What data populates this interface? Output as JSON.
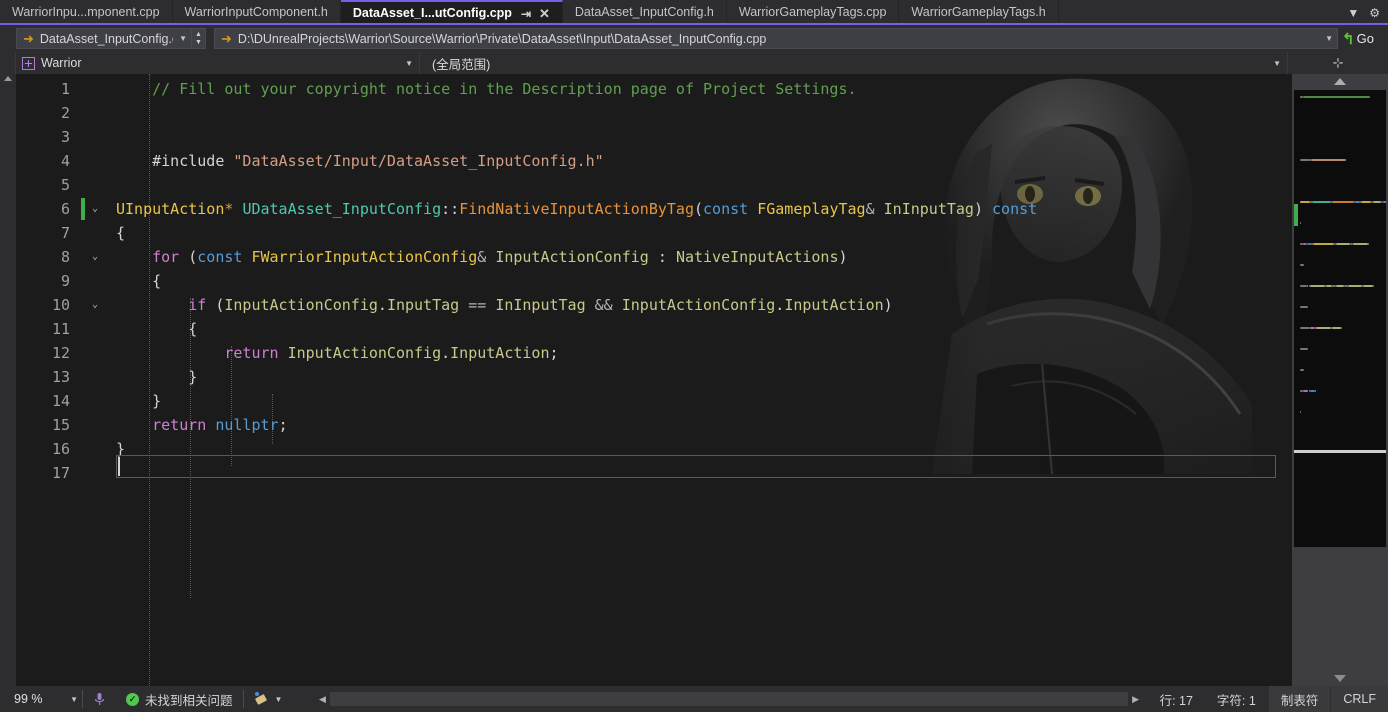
{
  "tabs": [
    {
      "label": "WarriorInpu...mponent.cpp",
      "active": false
    },
    {
      "label": "WarriorInputComponent.h",
      "active": false
    },
    {
      "label": "DataAsset_I...utConfig.cpp",
      "active": true,
      "pin": "⇥",
      "close": "✕"
    },
    {
      "label": "DataAsset_InputConfig.h",
      "active": false
    },
    {
      "label": "WarriorGameplayTags.cpp",
      "active": false
    },
    {
      "label": "WarriorGameplayTags.h",
      "active": false
    }
  ],
  "tabstrip_right": {
    "overflow_icon": "▼",
    "settings_icon": "⚙"
  },
  "navbar": {
    "back_arrow": "➜",
    "file_name": "DataAsset_InputConfig.c",
    "caret": "▼",
    "spin_up": "▲",
    "spin_down": "▼",
    "path_arrow": "➜",
    "path": "D:\\DUnrealProjects\\Warrior\\Source\\Warrior\\Private\\DataAsset\\Input\\DataAsset_InputConfig.cpp",
    "path_caret": "▼",
    "go_label": "Go",
    "go_arrow": "↰"
  },
  "scopebar": {
    "project": "Warrior",
    "project_caret": "▼",
    "scope": "(全局范围)",
    "scope_caret": "▼",
    "split_icon": "⊹"
  },
  "editor": {
    "colors": {
      "background": "#1b1b1b",
      "comment": "#5fa04e",
      "string": "#d69d85",
      "type": "#e8c547",
      "class": "#4ec9b0",
      "function": "#e8923c",
      "keyword": "#569cd6",
      "control": "#d17fd1",
      "variable": "#c8c88a",
      "accent": "#7160e8",
      "change_bar": "#3fae4a"
    },
    "lines": [
      {
        "n": "1",
        "fold": "",
        "change": false,
        "tokens": [
          {
            "t": "    ",
            "c": "c-punct"
          },
          {
            "t": "// Fill out your copyright notice in the Description page of Project Settings.",
            "c": "c-comment"
          }
        ]
      },
      {
        "n": "2",
        "fold": "",
        "change": false,
        "tokens": []
      },
      {
        "n": "3",
        "fold": "",
        "change": false,
        "tokens": []
      },
      {
        "n": "4",
        "fold": "",
        "change": false,
        "tokens": [
          {
            "t": "    #include ",
            "c": "c-pre"
          },
          {
            "t": "\"DataAsset/Input/DataAsset_InputConfig.h\"",
            "c": "c-str"
          }
        ]
      },
      {
        "n": "5",
        "fold": "",
        "change": false,
        "tokens": []
      },
      {
        "n": "6",
        "fold": "⌄",
        "change": true,
        "tokens": [
          {
            "t": "UInputAction",
            "c": "c-type"
          },
          {
            "t": "* ",
            "c": "c-func"
          },
          {
            "t": "UDataAsset_InputConfig",
            "c": "c-class"
          },
          {
            "t": "::",
            "c": "c-punct"
          },
          {
            "t": "FindNativeInputActionByTag",
            "c": "c-func"
          },
          {
            "t": "(",
            "c": "c-punct"
          },
          {
            "t": "const",
            "c": "c-kw"
          },
          {
            "t": " ",
            "c": "c-punct"
          },
          {
            "t": "FGameplayTag",
            "c": "c-type"
          },
          {
            "t": "& ",
            "c": "c-op"
          },
          {
            "t": "InInputTag",
            "c": "c-var"
          },
          {
            "t": ") ",
            "c": "c-punct"
          },
          {
            "t": "const",
            "c": "c-kw"
          }
        ]
      },
      {
        "n": "7",
        "fold": "",
        "change": false,
        "tokens": [
          {
            "t": "{",
            "c": "c-punct"
          }
        ]
      },
      {
        "n": "8",
        "fold": "⌄",
        "change": false,
        "tokens": [
          {
            "t": "    ",
            "c": "c-punct"
          },
          {
            "t": "for",
            "c": "c-ctrl"
          },
          {
            "t": " (",
            "c": "c-punct"
          },
          {
            "t": "const",
            "c": "c-kw"
          },
          {
            "t": " ",
            "c": "c-punct"
          },
          {
            "t": "FWarriorInputActionConfig",
            "c": "c-type"
          },
          {
            "t": "& ",
            "c": "c-op"
          },
          {
            "t": "InputActionConfig",
            "c": "c-var"
          },
          {
            "t": " : ",
            "c": "c-punct"
          },
          {
            "t": "NativeInputActions",
            "c": "c-var"
          },
          {
            "t": ")",
            "c": "c-punct"
          }
        ]
      },
      {
        "n": "9",
        "fold": "",
        "change": false,
        "tokens": [
          {
            "t": "    {",
            "c": "c-punct"
          }
        ]
      },
      {
        "n": "10",
        "fold": "⌄",
        "change": false,
        "tokens": [
          {
            "t": "        ",
            "c": "c-punct"
          },
          {
            "t": "if",
            "c": "c-ctrl"
          },
          {
            "t": " (",
            "c": "c-punct"
          },
          {
            "t": "InputActionConfig",
            "c": "c-var"
          },
          {
            "t": ".",
            "c": "c-punct"
          },
          {
            "t": "InputTag",
            "c": "c-var"
          },
          {
            "t": " == ",
            "c": "c-op"
          },
          {
            "t": "InInputTag",
            "c": "c-var"
          },
          {
            "t": " && ",
            "c": "c-op"
          },
          {
            "t": "InputActionConfig",
            "c": "c-var"
          },
          {
            "t": ".",
            "c": "c-punct"
          },
          {
            "t": "InputAction",
            "c": "c-var"
          },
          {
            "t": ")",
            "c": "c-punct"
          }
        ]
      },
      {
        "n": "11",
        "fold": "",
        "change": false,
        "tokens": [
          {
            "t": "        {",
            "c": "c-punct"
          }
        ]
      },
      {
        "n": "12",
        "fold": "",
        "change": false,
        "tokens": [
          {
            "t": "            ",
            "c": "c-punct"
          },
          {
            "t": "return",
            "c": "c-ctrl"
          },
          {
            "t": " ",
            "c": "c-punct"
          },
          {
            "t": "InputActionConfig",
            "c": "c-var"
          },
          {
            "t": ".",
            "c": "c-punct"
          },
          {
            "t": "InputAction",
            "c": "c-var"
          },
          {
            "t": ";",
            "c": "c-punct"
          }
        ]
      },
      {
        "n": "13",
        "fold": "",
        "change": false,
        "tokens": [
          {
            "t": "        }",
            "c": "c-punct"
          }
        ]
      },
      {
        "n": "14",
        "fold": "",
        "change": false,
        "tokens": [
          {
            "t": "    }",
            "c": "c-punct"
          }
        ]
      },
      {
        "n": "15",
        "fold": "",
        "change": false,
        "tokens": [
          {
            "t": "    ",
            "c": "c-punct"
          },
          {
            "t": "return",
            "c": "c-ctrl"
          },
          {
            "t": " ",
            "c": "c-punct"
          },
          {
            "t": "nullptr",
            "c": "c-kw"
          },
          {
            "t": ";",
            "c": "c-punct"
          }
        ]
      },
      {
        "n": "16",
        "fold": "",
        "change": false,
        "tokens": [
          {
            "t": "}",
            "c": "c-punct"
          }
        ]
      },
      {
        "n": "17",
        "fold": "",
        "change": false,
        "tokens": []
      }
    ]
  },
  "minimap": {
    "scroll_up": "▲",
    "scroll_down": "▼"
  },
  "statusbar": {
    "zoom": "99 %",
    "zoom_caret": "▼",
    "mic_icon": "mic-icon",
    "status_ok_glyph": "✓",
    "status_text": "未找到相关问题",
    "brush_caret": "▼",
    "scroll_left": "◀",
    "scroll_right": "▶",
    "line_label": "行: 17",
    "char_label": "字符: 1",
    "indent_label": "制表符",
    "eol_label": "CRLF"
  }
}
